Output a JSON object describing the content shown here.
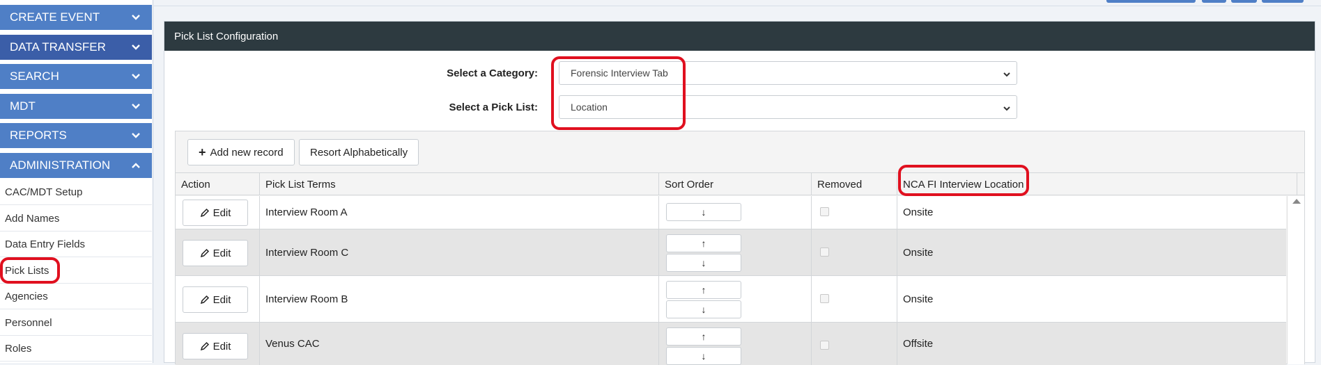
{
  "sidebar": {
    "sections": [
      {
        "label": "CREATE EVENT",
        "expanded": false
      },
      {
        "label": "DATA TRANSFER",
        "expanded": false
      },
      {
        "label": "SEARCH",
        "expanded": false
      },
      {
        "label": "MDT",
        "expanded": false
      },
      {
        "label": "REPORTS",
        "expanded": false
      },
      {
        "label": "ADMINISTRATION",
        "expanded": true
      }
    ],
    "items": [
      "CAC/MDT Setup",
      "Add Names",
      "Data Entry Fields",
      "Pick Lists",
      "Agencies",
      "Personnel",
      "Roles"
    ]
  },
  "panel": {
    "title": "Pick List Configuration",
    "category_label": "Select a Category:",
    "category_value": "Forensic Interview Tab",
    "picklist_label": "Select a Pick List:",
    "picklist_value": "Location"
  },
  "toolbar": {
    "add_label": "Add new record",
    "resort_label": "Resort Alphabetically"
  },
  "table": {
    "columns": [
      "Action",
      "Pick List Terms",
      "Sort Order",
      "Removed",
      "NCA FI Interview Location"
    ],
    "edit_label": "Edit",
    "up_arrow": "↑",
    "down_arrow": "↓",
    "rows": [
      {
        "term": "Interview Room A",
        "removed": false,
        "location": "Onsite"
      },
      {
        "term": "Interview Room C",
        "removed": false,
        "location": "Onsite"
      },
      {
        "term": "Interview Room B",
        "removed": false,
        "location": "Onsite"
      },
      {
        "term": "Venus CAC",
        "removed": false,
        "location": "Offsite"
      }
    ]
  },
  "colors": {
    "nav_blue": "#4f7fc6",
    "nav_blue_dark": "#3b5ea8",
    "header_dark": "#2d3a40",
    "highlight_red": "#e0101f"
  }
}
